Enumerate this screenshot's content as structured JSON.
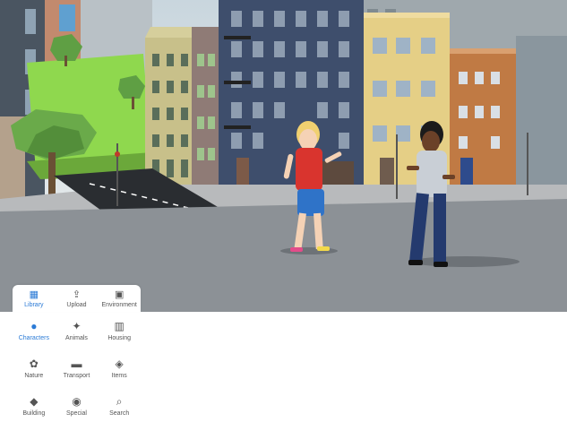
{
  "tabs": [
    {
      "label": "Library",
      "icon": "grid-icon",
      "active": true
    },
    {
      "label": "Upload",
      "icon": "upload-icon",
      "active": false
    },
    {
      "label": "Environment",
      "icon": "image-icon",
      "active": false
    }
  ],
  "categories": [
    {
      "label": "Characters",
      "icon": "person-icon",
      "active": true
    },
    {
      "label": "Animals",
      "icon": "dog-icon",
      "active": false
    },
    {
      "label": "Housing",
      "icon": "buildings-icon",
      "active": false
    },
    {
      "label": "Nature",
      "icon": "plant-icon",
      "active": false
    },
    {
      "label": "Transport",
      "icon": "car-icon",
      "active": false
    },
    {
      "label": "Items",
      "icon": "gem-icon",
      "active": false
    },
    {
      "label": "Building",
      "icon": "shapes-icon",
      "active": false
    },
    {
      "label": "Special",
      "icon": "camera-icon",
      "active": false
    },
    {
      "label": "Search",
      "icon": "search-icon",
      "active": false
    }
  ],
  "colors": {
    "accent": "#2b7bd6"
  }
}
